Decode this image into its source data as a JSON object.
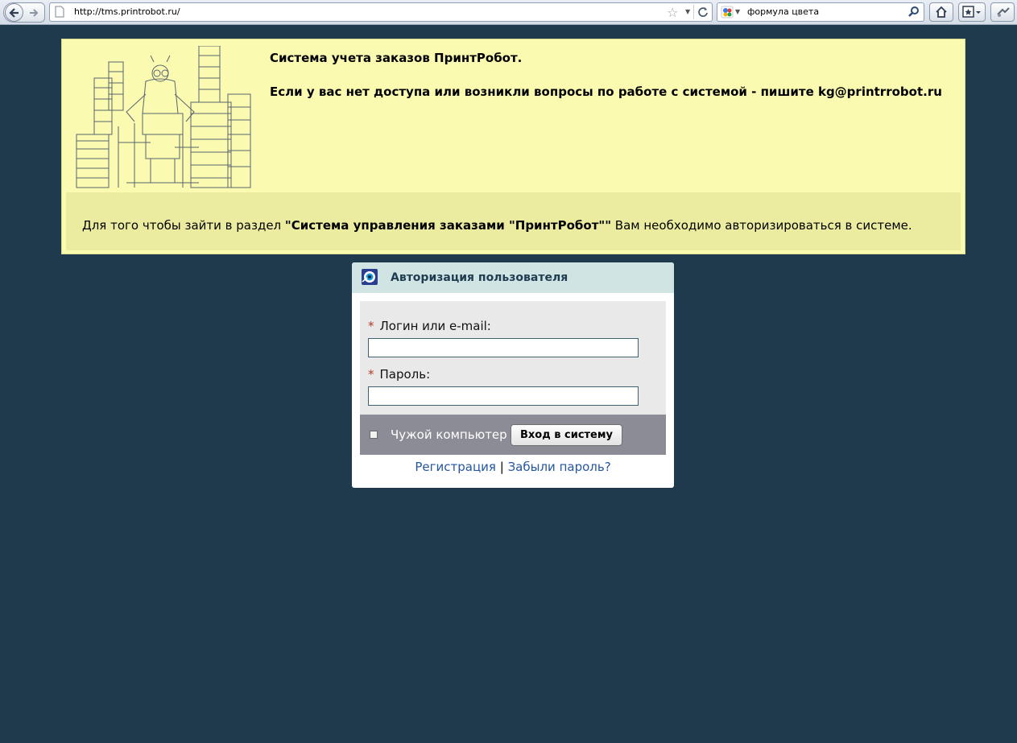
{
  "browser": {
    "url": "http://tms.printrobot.ru/",
    "search_text": "формула цвета"
  },
  "header": {
    "title": "Система учета заказов ПринтРобот.",
    "contact": "Если у вас нет доступа или возникли вопросы по работе с системой - пишите kg@printrrobot.ru",
    "notice_prefix": "Для того чтобы зайти в раздел ",
    "notice_highlight": "\"Система управления заказами \"ПринтРобот\"\"",
    "notice_suffix": " Вам необходимо авторизироваться в системе."
  },
  "login": {
    "title": "Авторизация пользователя",
    "required_mark": "*",
    "login_label": "Логин или e-mail:",
    "login_value": "",
    "password_label": "Пароль:",
    "password_value": "",
    "foreign_computer_label": "Чужой компьютер",
    "submit_label": "Вход в систему",
    "register_link": "Регистрация",
    "separator": "|",
    "forgot_link": "Забыли пароль?"
  },
  "colors": {
    "page_bg": "#1e3a4c",
    "header_bg": "#fafab0",
    "notice_bg": "#ececa0",
    "login_head_bg": "#d1e4e4",
    "link": "#2556a3"
  }
}
